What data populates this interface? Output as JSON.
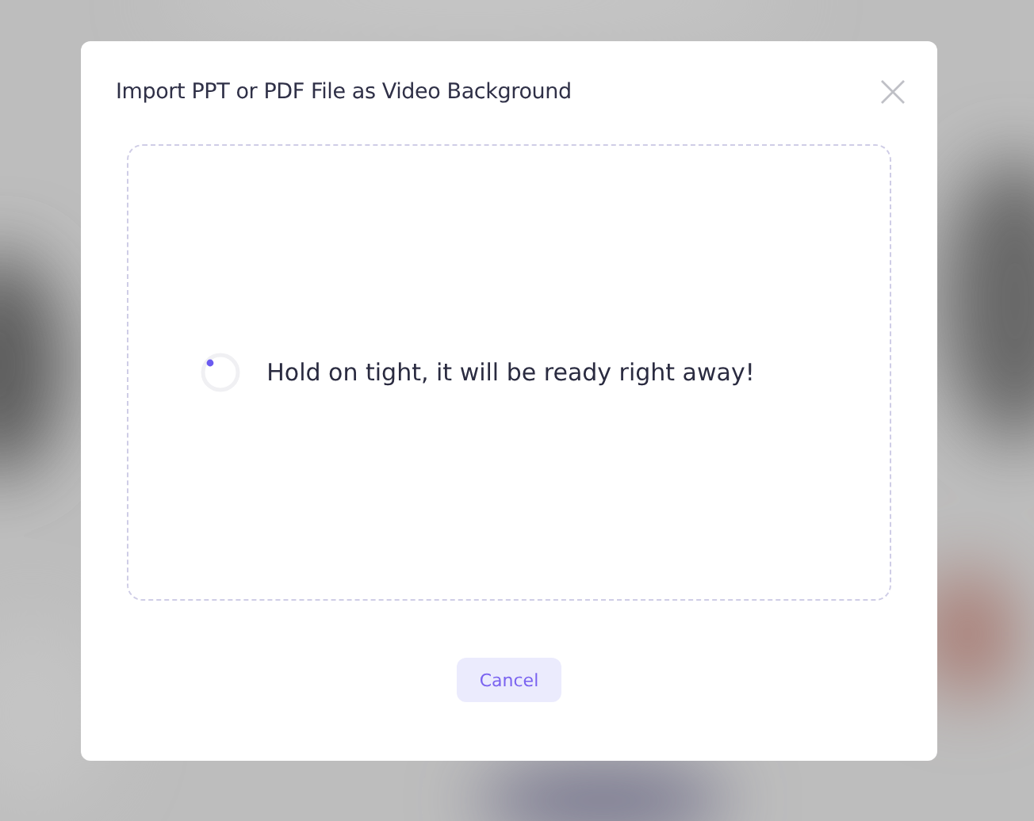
{
  "dialog": {
    "title": "Import PPT or PDF File as Video Background",
    "upload_area": {
      "status": "Hold on tight, it will be ready right away!"
    },
    "buttons": [
      {
        "label": "Cancel",
        "kind": "secondary"
      }
    ]
  }
}
